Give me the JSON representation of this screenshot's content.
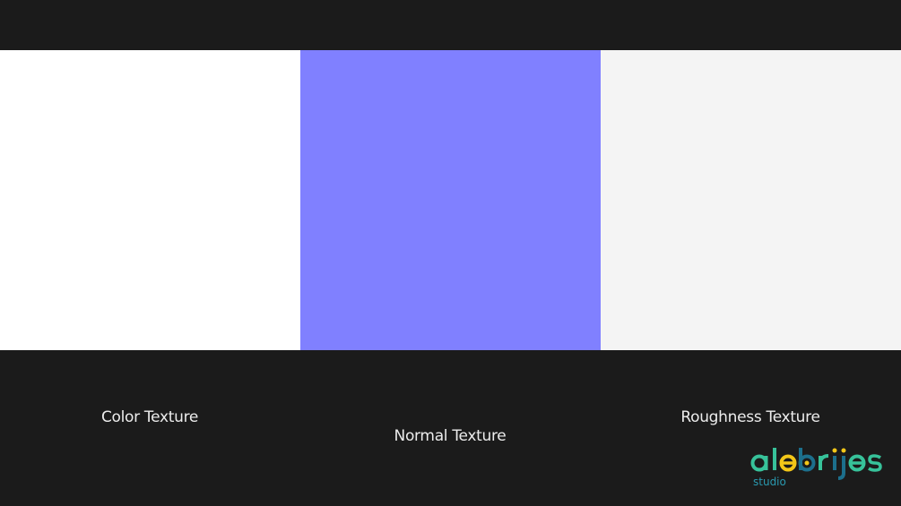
{
  "textures": [
    {
      "label": "Color Texture",
      "color": "#ffffff"
    },
    {
      "label": "Normal Texture",
      "color": "#8080ff"
    },
    {
      "label": "Roughness Texture",
      "color": "#f4f4f4"
    }
  ],
  "logo": {
    "wordmark": "alebrijes",
    "subtitle": "studio",
    "colors": {
      "green": "#37c29a",
      "yellow": "#f3c718",
      "teal": "#1c6f8c",
      "text": "#2a9ab0"
    }
  },
  "background": "#1b1b1b"
}
